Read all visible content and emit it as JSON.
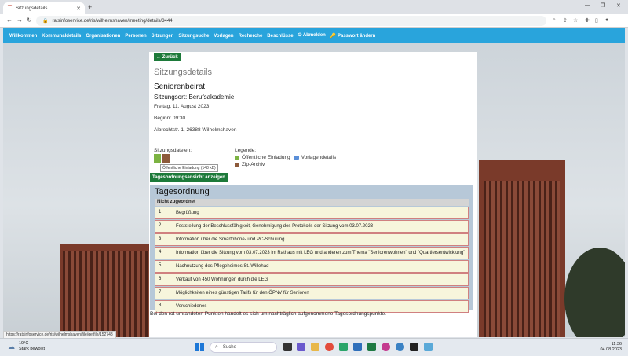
{
  "browser": {
    "tab_title": "Sitzungsdetails",
    "url": "ratsinfoservice.de/ris/wilhelmshaven/meeting/details/3444"
  },
  "menu": {
    "items": [
      "Willkommen",
      "Kommunaldetails",
      "Organisationen",
      "Personen",
      "Sitzungen",
      "Sitzungsuche",
      "Vorlagen",
      "Recherche",
      "Beschlüsse",
      "Abmelden",
      "Passwort ändern"
    ]
  },
  "page": {
    "back_label": "← Zurück",
    "section_title": "Sitzungsdetails",
    "gremium": "Seniorenbeirat",
    "ort": "Sitzungsort: Berufsakademie",
    "datum": "Freitag, 11. August 2023",
    "beginn": "Beginn: 09:30",
    "adresse": "Albrechtstr. 1, 26388 Wilhelmshaven",
    "files_label": "Sitzungsdateien:",
    "legend_label": "Legende:",
    "legend_invitation": "Öffentliche Einladung",
    "legend_vorlagen": "Vorlagendetails",
    "legend_zip": "Zip-Archiv",
    "tooltip": "Öffentliche Einladung (148 kB)",
    "show_agenda_label": "Tagesordnungsansicht anzeigen"
  },
  "agenda": {
    "title": "Tagesordnung",
    "subheader": "Nicht zugeordnet",
    "items": [
      {
        "num": "1",
        "text": "Begrüßung"
      },
      {
        "num": "2",
        "text": "Feststellung der Beschlussfähigkeit, Genehmigung des Protokolls der Sitzung vom 03.07.2023"
      },
      {
        "num": "3",
        "text": "Information über die Smartphone- und PC-Schulung"
      },
      {
        "num": "4",
        "text": "Information über die Sitzung vom 03.07.2023 im Rathaus mit LEG und anderen zum Thema \"Seniorenwohnen\" und \"Quartiersentwicklung\""
      },
      {
        "num": "5",
        "text": "Nachnutzung des Pflegeheimes St. Willehad"
      },
      {
        "num": "6",
        "text": "Verkauf von 450 Wohnungen durch die LEG"
      },
      {
        "num": "7",
        "text": "Möglichkeiten eines günstigen Tarifs für den ÖPNV für Senioren"
      },
      {
        "num": "8",
        "text": "Verschiedenes"
      }
    ],
    "footnote": "Bei den rot umrandeten Punkten handelt es sich um nachträglich aufgenommene Tagesordnungspunkte."
  },
  "status_url": "https://ratsinfoservice.de/ris/wilhelmshaven/file/getfile/152748",
  "taskbar": {
    "weather_temp": "19°C",
    "weather_desc": "Stark bewölkt",
    "search_label": "Suche",
    "time": "11:36",
    "date": "04.08.2023"
  }
}
